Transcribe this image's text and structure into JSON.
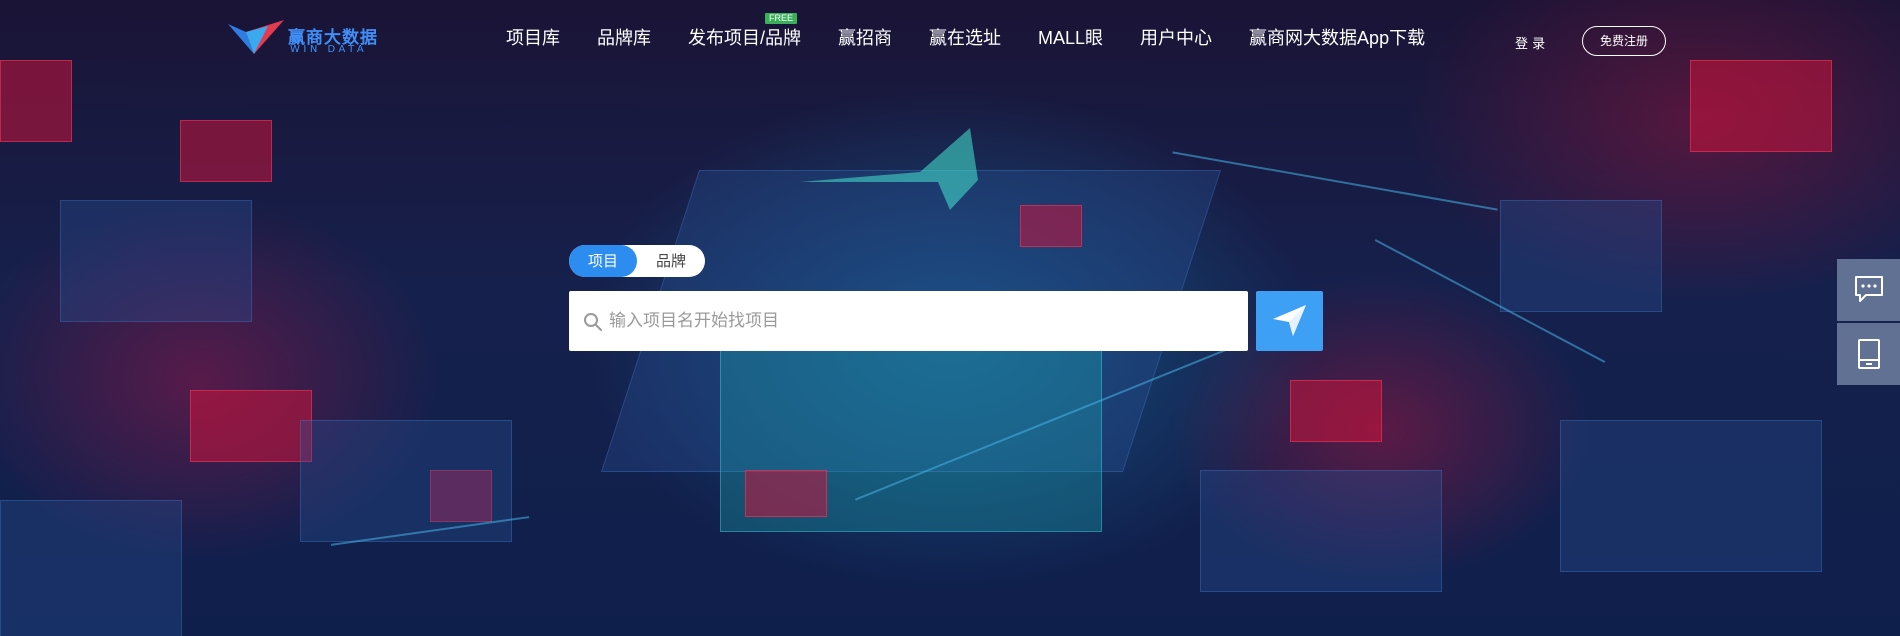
{
  "header": {
    "logo": {
      "brand_cn": "赢商大数据",
      "brand_en": "WIN DATA",
      "icon": "logo-icon"
    },
    "nav": [
      {
        "label": "项目库",
        "badge": ""
      },
      {
        "label": "品牌库",
        "badge": ""
      },
      {
        "label": "发布项目/品牌",
        "badge": "FREE"
      },
      {
        "label": "赢招商",
        "badge": ""
      },
      {
        "label": "赢在选址",
        "badge": ""
      },
      {
        "label": "MALL眼",
        "badge": ""
      },
      {
        "label": "用户中心",
        "badge": ""
      },
      {
        "label": "赢商网大数据App下载",
        "badge": ""
      }
    ],
    "login_label": "登 录",
    "register_label": "免费注册"
  },
  "search": {
    "tabs": [
      {
        "label": "项目",
        "active": true
      },
      {
        "label": "品牌",
        "active": false
      }
    ],
    "placeholder": "输入项目名开始找项目",
    "value": "",
    "search_icon": "search-icon",
    "submit_icon": "paper-plane-icon"
  },
  "side": {
    "buttons": [
      {
        "icon": "chat-bubble-icon"
      },
      {
        "icon": "mobile-app-icon"
      }
    ]
  },
  "colors": {
    "accent": "#2d8cf0",
    "search_button": "#3da0f5",
    "free_badge": "#3ab05b",
    "side_button": "#6e80a0"
  }
}
